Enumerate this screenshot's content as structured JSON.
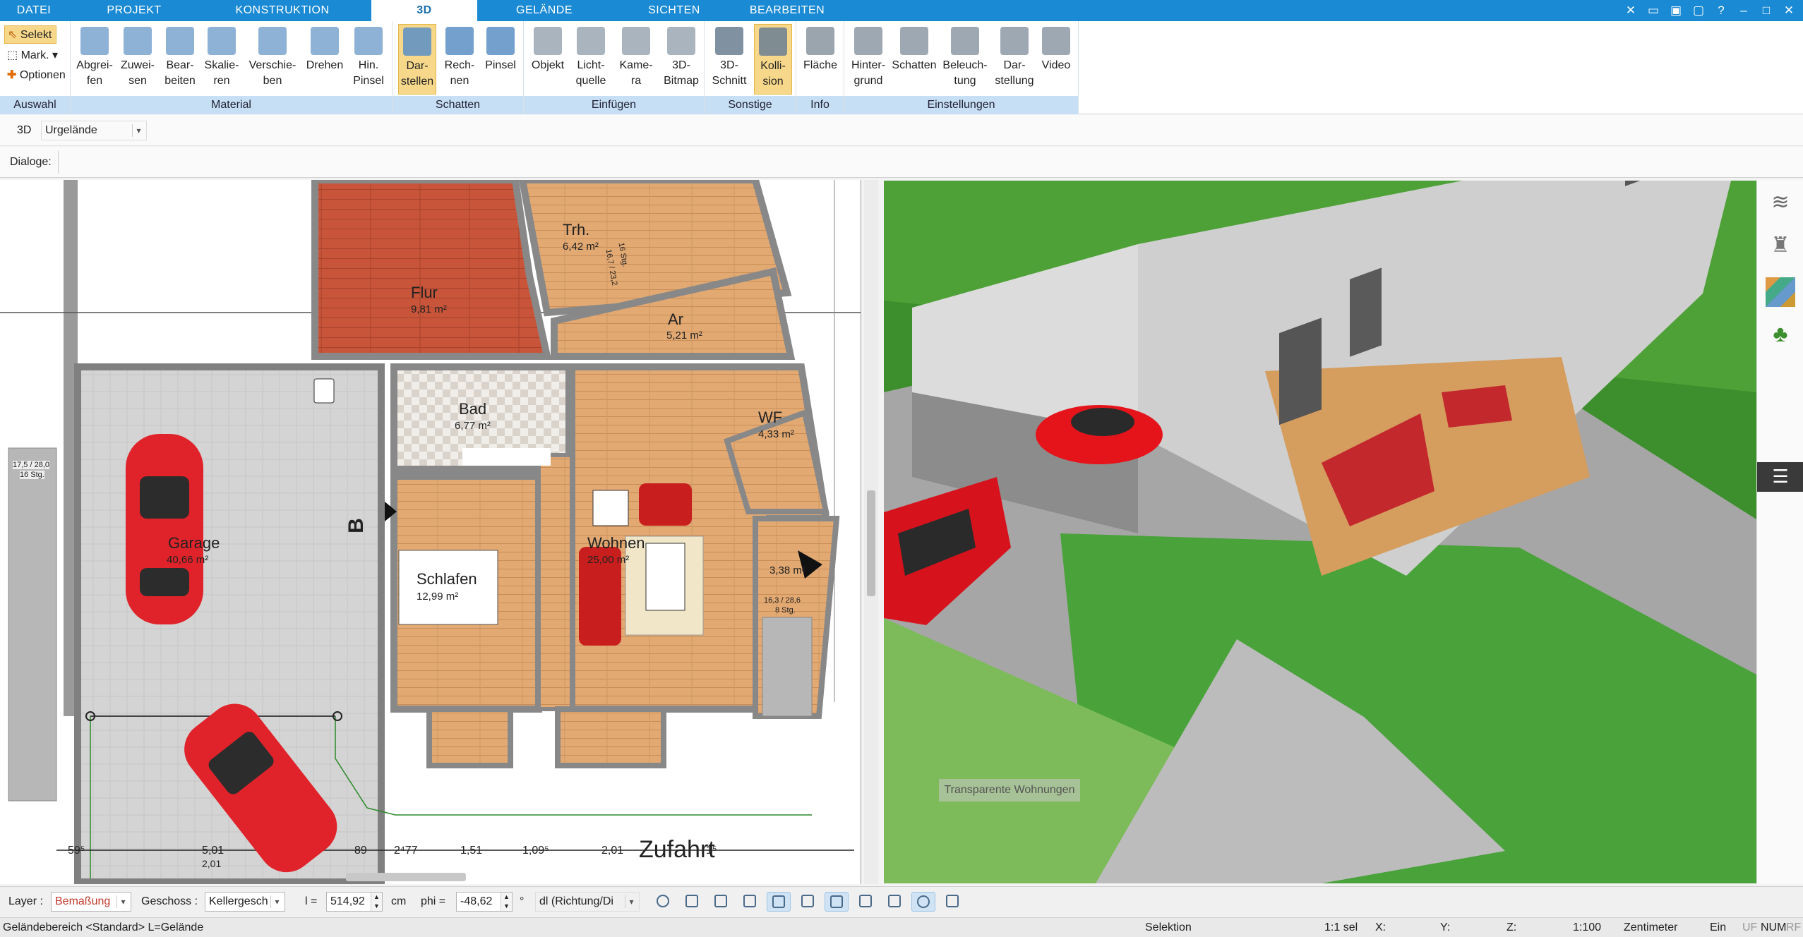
{
  "tabs": [
    "DATEI",
    "PROJEKT",
    "KONSTRUKTION",
    "3D",
    "GELÄNDE",
    "SICHTEN",
    "BEARBEITEN"
  ],
  "ribbon": {
    "auswahl": {
      "label": "Auswahl",
      "selekt": "Selekt",
      "mark": "Mark.",
      "optionen": "Optionen"
    },
    "material": {
      "label": "Material",
      "buttons": [
        "Abgrei-\nfen",
        "Zuwei-\nsen",
        "Bear-\nbeiten",
        "Skalie-\nren",
        "Verschie-\nben",
        "Drehen",
        "Hin.\nPinsel"
      ]
    },
    "schatten": {
      "label": "Schatten",
      "buttons": [
        "Dar-\nstellen",
        "Rech-\nnen",
        "Pinsel"
      ]
    },
    "einfuegen": {
      "label": "Einfügen",
      "buttons": [
        "Objekt",
        "Licht-\nquelle",
        "Kame-\nra",
        "3D-\nBitmap"
      ]
    },
    "sonstige": {
      "label": "Sonstige",
      "buttons": [
        "3D-\nSchnitt",
        "Kolli-\nsion"
      ]
    },
    "info": {
      "label": "Info",
      "buttons": [
        "Fläche"
      ]
    },
    "einstellungen": {
      "label": "Einstellungen",
      "buttons": [
        "Hinter-\ngrund",
        "Schatten",
        "Beleuch-\ntung",
        "Dar-\nstellung",
        "Video"
      ]
    }
  },
  "row3d": {
    "label": "3D",
    "terrain": "Urgelände"
  },
  "dialogs": {
    "label": "Dialoge:"
  },
  "plan": {
    "rooms": [
      {
        "name": "Trh.",
        "area": "6,42 m²"
      },
      {
        "name": "Flur",
        "area": "9,81 m²"
      },
      {
        "name": "Ar",
        "area": "5,21 m²"
      },
      {
        "name": "Bad",
        "area": "6,77 m²"
      },
      {
        "name": "WF",
        "area": "4,33 m²"
      },
      {
        "name": "Garage",
        "area": "40,66 m²"
      },
      {
        "name": "Wohnen",
        "area": "25,00 m²"
      },
      {
        "name": "Schlafen",
        "area": "12,99 m²"
      },
      {
        "name": "",
        "area": "3,38 m²"
      }
    ],
    "stair_labels": [
      "16 Stg.",
      "16,7 / 23,2",
      "17,5 / 28,0",
      "16 Stg.",
      "16,3 / 28,6",
      "8 Stg."
    ],
    "section_mark": "B",
    "dimensions": [
      "59⁵",
      "5,01",
      "2,01",
      "89",
      "2⁴77",
      "1,51",
      "1,09⁵",
      "2,01",
      "1⁵"
    ],
    "driveway": "Zufahrt"
  },
  "view3d": {
    "watermark": "Transparente Wohnungen"
  },
  "bottom": {
    "layer_label": "Layer :",
    "layer_value": "Bemaßung",
    "geschoss_label": "Geschoss :",
    "geschoss_value": "Kellergesch",
    "l_label": "l =",
    "l_value": "514,92",
    "l_unit": "cm",
    "phi_label": "phi =",
    "phi_value": "-48,62",
    "phi_unit": "°",
    "mode_value": "dl (Richtung/Di"
  },
  "status": {
    "left": "Geländebereich <Standard> L=Gelände",
    "mode": "Selektion",
    "scale_sel": "1:1 sel",
    "x": "X:",
    "y": "Y:",
    "z": "Z:",
    "scale": "1:100",
    "unit": "Zentimeter",
    "ein": "Ein",
    "flags": [
      "UF",
      "NUM",
      "RF"
    ]
  },
  "colors": {
    "accent": "#1a8ad4",
    "ribbon_group": "#c6dff4",
    "active": "#f7d88a"
  }
}
